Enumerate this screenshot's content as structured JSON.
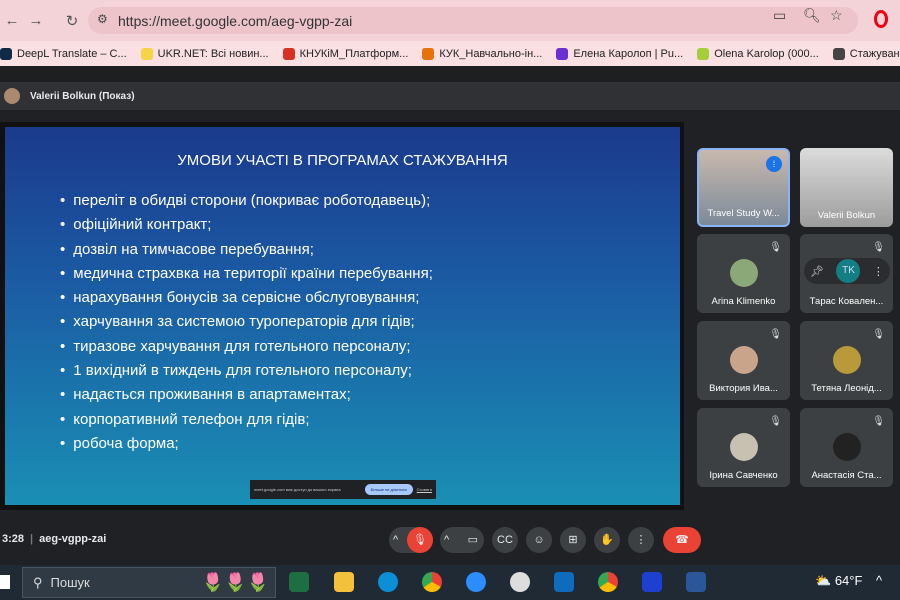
{
  "browser": {
    "url": "https://meet.google.com/aeg-vgpp-zai",
    "bookmarks": [
      {
        "label": "DeepL Translate – C...",
        "color": "#0f2b46"
      },
      {
        "label": "UKR.NET: Всі новин...",
        "color": "#f5d547"
      },
      {
        "label": "КНУКіМ_Платформ...",
        "color": "#d93025"
      },
      {
        "label": "КУК_Навчально-ін...",
        "color": "#e8710a"
      },
      {
        "label": "Елена Каролоп | Pu...",
        "color": "#6b2fd4"
      },
      {
        "label": "Olena Karolop (000...",
        "color": "#a6ce39"
      },
      {
        "label": "Стажування за кор",
        "color": "#444444"
      }
    ]
  },
  "meet": {
    "presenter": "Valerii Bolkun (Показ)",
    "time": "3:28",
    "code": "aeg-vgpp-zai"
  },
  "slide": {
    "title": "УМОВИ УЧАСТІ В ПРОГРАМАХ СТАЖУВАННЯ",
    "bullets": [
      "переліт в обидві сторони (покриває роботодавець);",
      "офіційний контракт;",
      "дозвіл на тимчасове перебування;",
      "медична страхвка на території країни перебування;",
      "нарахування бонусів за сервісне обслуговування;",
      "харчування за системою туроператорів для гідів;",
      "тиразове харчування для готельного персоналу;",
      "1 вихідний в тиждень для готельного персоналу;",
      "надається проживання в апартаментах;",
      "корпоративний телефон для гідів;",
      "робоча форма;"
    ]
  },
  "share_banner": {
    "text": "meet.google.com має доступ до вашого екрана",
    "stop": "Більше не ділитися",
    "hide": "Сховати"
  },
  "participants": [
    "Travel Study W...",
    "Valerii Bolkun",
    "Arina Klimenko",
    "Тарас Ковален...",
    "Виктория Ива...",
    "Тетяна Леонід...",
    "Ірина Савченко",
    "Анастасія Ста..."
  ],
  "hover_avatar_initials": "TK",
  "taskbar": {
    "search": "Пошук",
    "weather": "64°F"
  },
  "colors": {
    "end_call": "#ea4335",
    "accent": "#8ab4f8"
  }
}
